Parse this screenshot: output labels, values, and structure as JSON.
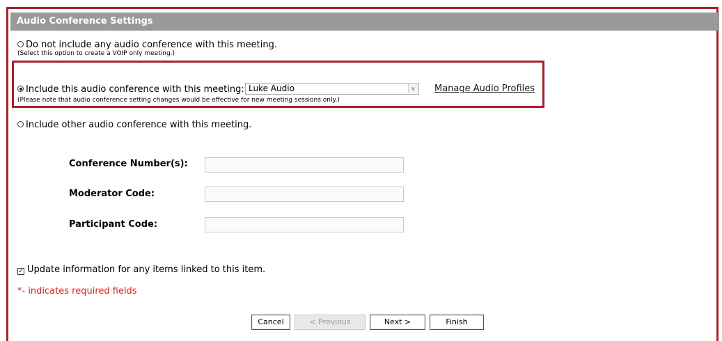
{
  "header": {
    "title": "Audio Conference Settings"
  },
  "options": {
    "no_audio": {
      "label": "Do not include any audio conference with this meeting.",
      "note": "(Select this option to create a VOIP only meeting.)",
      "selected": false
    },
    "include_this": {
      "label": "Include this audio conference with this meeting:",
      "note": "(Please note that audio conference setting changes would be effective for new meeting sessions only.)",
      "selected": true,
      "selected_profile": "Luke Audio",
      "manage_link": "Manage Audio Profiles"
    },
    "include_other": {
      "label": "Include other audio conference with this meeting.",
      "selected": false
    }
  },
  "fields": {
    "conference_numbers": {
      "label": "Conference Number(s):",
      "value": ""
    },
    "moderator_code": {
      "label": "Moderator Code:",
      "value": ""
    },
    "participant_code": {
      "label": "Participant Code:",
      "value": ""
    }
  },
  "update_linked": {
    "label": "Update information for any items linked to this item.",
    "checked": true
  },
  "required_note": "*- indicates required fields",
  "buttons": {
    "cancel": "Cancel",
    "previous": "< Previous",
    "next": "Next >",
    "finish": "Finish"
  },
  "colors": {
    "highlight_border": "#a8202a",
    "header_bg": "#999999",
    "required_text": "#e02020"
  }
}
